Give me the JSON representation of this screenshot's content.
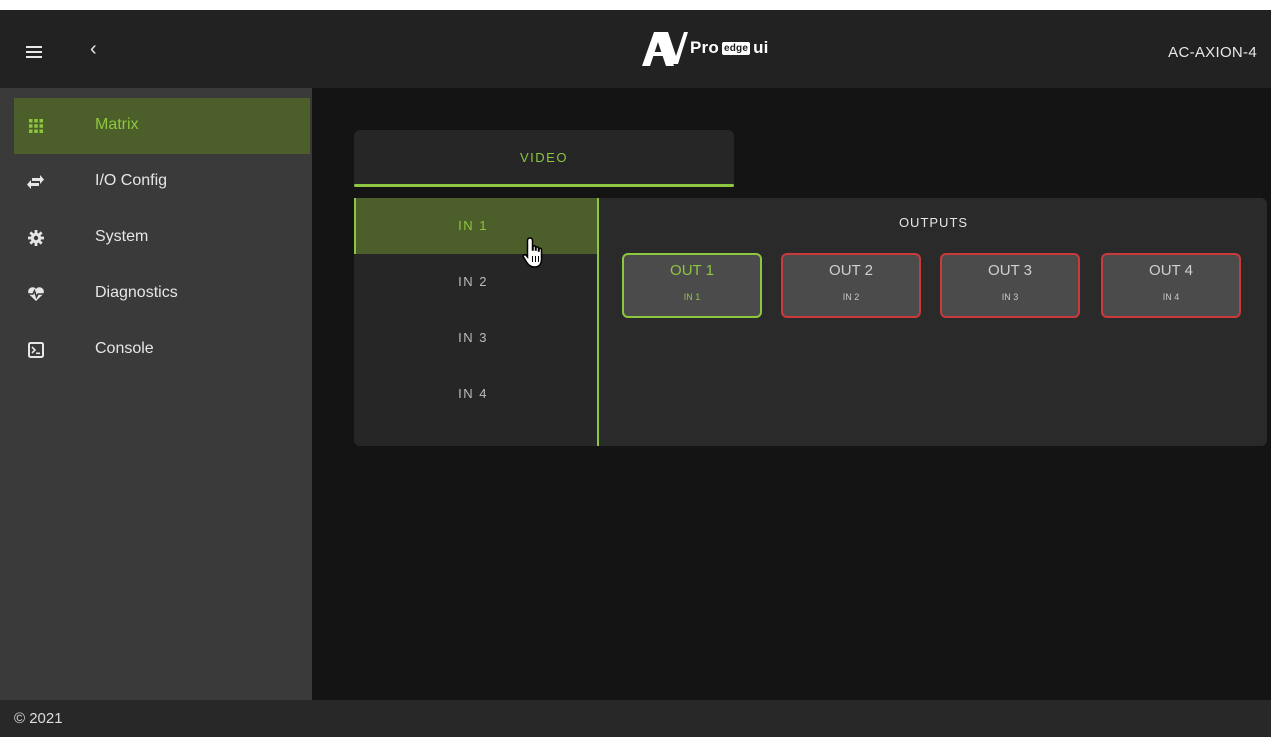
{
  "header": {
    "logo_main": "Pro",
    "logo_edge": "edge",
    "logo_suffix": "ui",
    "device_name": "AC-AXION-4"
  },
  "sidebar": {
    "items": [
      {
        "label": "Matrix",
        "icon": "grid-icon"
      },
      {
        "label": "I/O Config",
        "icon": "swap-arrows-icon"
      },
      {
        "label": "System",
        "icon": "gear-icon"
      },
      {
        "label": "Diagnostics",
        "icon": "heartbeat-icon"
      },
      {
        "label": "Console",
        "icon": "terminal-icon"
      }
    ],
    "active": "Matrix"
  },
  "tabs": [
    {
      "label": "VIDEO"
    }
  ],
  "inputs": [
    {
      "label": "IN 1"
    },
    {
      "label": "IN 2"
    },
    {
      "label": "IN 3"
    },
    {
      "label": "IN 4"
    }
  ],
  "outputs_title": "OUTPUTS",
  "outputs": [
    {
      "label": "OUT 1",
      "source": "IN 1"
    },
    {
      "label": "OUT 2",
      "source": "IN 2"
    },
    {
      "label": "OUT 3",
      "source": "IN 3"
    },
    {
      "label": "OUT 4",
      "source": "IN 4"
    }
  ],
  "footer": {
    "copyright": "© 2021"
  },
  "colors": {
    "accent": "#8dc63f",
    "unrouted": "#c93a3a",
    "active_bg": "#4c5f2a"
  }
}
